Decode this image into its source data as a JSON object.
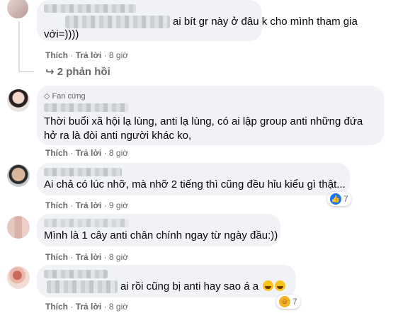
{
  "comments": [
    {
      "text_lines": [
        "ai bít gr này ở đâu k cho mình tham gia",
        "với=))))"
      ],
      "meta": {
        "like": "Thích",
        "reply": "Trả lời",
        "time": "8 giờ"
      },
      "replies_link": "2 phản hồi"
    },
    {
      "badge": "Fan cứng",
      "text_lines": [
        "Thời buổi xã hội lạ lùng, anti lạ lùng, có ai lập group anti những đứa",
        "hở ra là đòi anti người khác ko,"
      ],
      "meta": {
        "like": "Thích",
        "reply": "Trả lời",
        "time": "8 giờ"
      }
    },
    {
      "text_lines": [
        "Ai chả có lúc nhỡ, mà nhỡ 2 tiếng thì cũng đều hỉu kiểu gì thật..."
      ],
      "meta": {
        "like": "Thích",
        "reply": "Trả lời",
        "time": "9 giờ"
      },
      "reaction_count": "7"
    },
    {
      "name_partial": "Hoàng Anh V",
      "text_lines": [
        "Mình là 1 cây anti chân chính ngay từ ngày đầu:))"
      ],
      "meta": {
        "like": "Thích",
        "reply": "Trả lời",
        "time": "8 giờ"
      }
    },
    {
      "name_partial": "A",
      "text_lines": [
        "ai rồi cũng bị anti hay sao á a"
      ],
      "meta": {
        "like": "Thích",
        "reply": "Trả lời",
        "time": "8 giờ"
      },
      "reaction_count": "7"
    }
  ],
  "separator": "·",
  "icons": {
    "reply_arrow": "reply-arrow-icon",
    "fan_badge": "diamond-icon",
    "like": "like-icon",
    "haha": "haha-icon"
  },
  "colors": {
    "bubble": "#f0f2f5",
    "meta": "#65676b",
    "like_blue": "#1877f2"
  }
}
